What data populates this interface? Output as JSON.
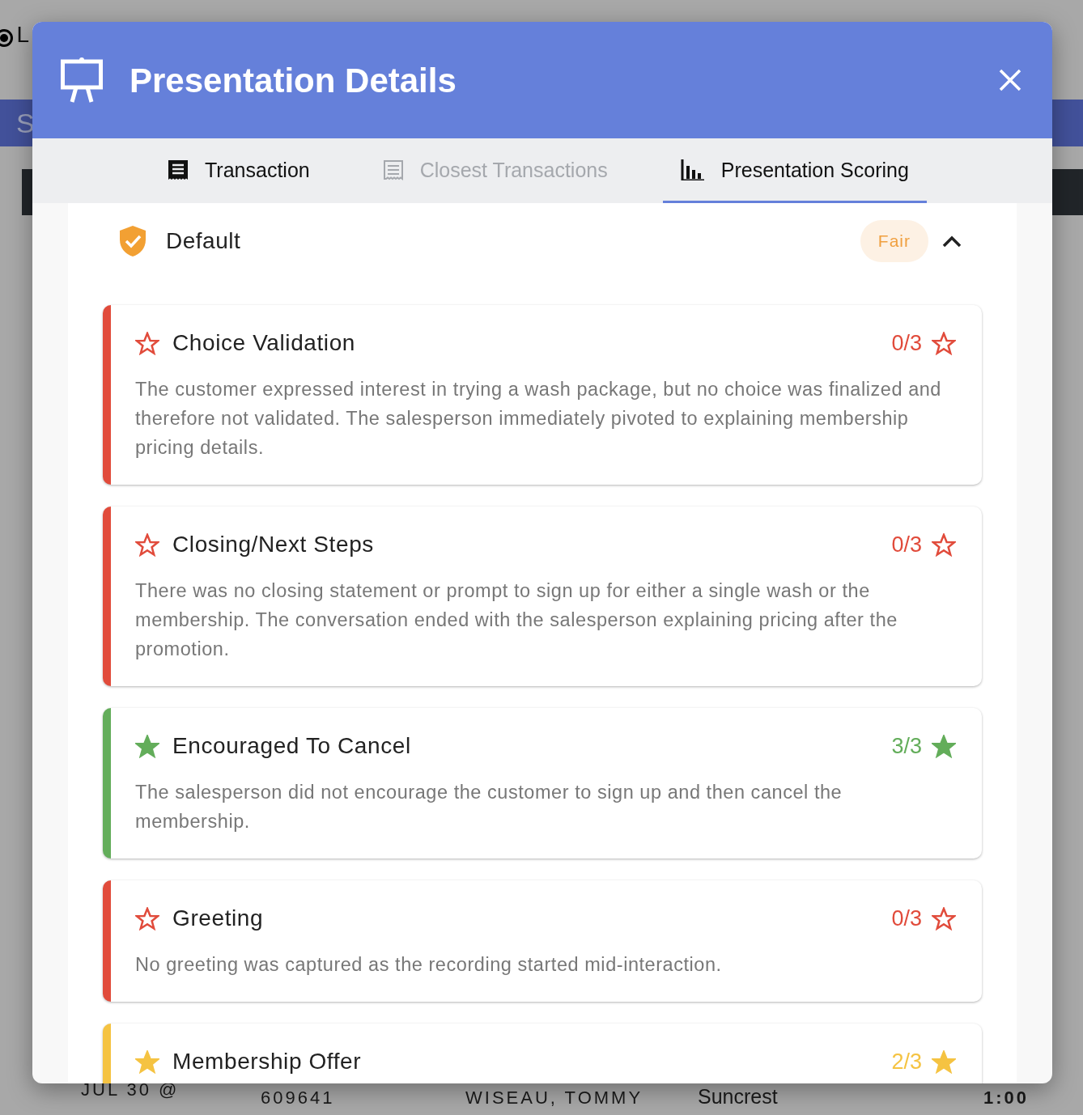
{
  "background": {
    "radio_checked": true,
    "radio_label": "L",
    "bar_text": "S",
    "row": {
      "date": "JUL 30 @",
      "number": "609641",
      "name": "WISEAU, TOMMY",
      "location": "Suncrest",
      "duration": "1:00"
    }
  },
  "dialog": {
    "title": "Presentation Details"
  },
  "tabs": [
    {
      "label": "Transaction",
      "selected": false,
      "disabled": false
    },
    {
      "label": "Closest Transactions",
      "selected": false,
      "disabled": true
    },
    {
      "label": "Presentation Scoring",
      "selected": true,
      "disabled": false
    }
  ],
  "section": {
    "title": "Default",
    "rating": "Fair",
    "expanded": true,
    "items": [
      {
        "title": "Choice Validation",
        "score": "0/3",
        "color": "#e14b3b",
        "star_filled": false,
        "description": "The customer expressed interest in trying a wash package, but no choice was finalized and therefore not validated. The salesperson immediately pivoted to explaining membership pricing details."
      },
      {
        "title": "Closing/Next Steps",
        "score": "0/3",
        "color": "#e14b3b",
        "star_filled": false,
        "description": "There was no closing statement or prompt to sign up for either a single wash or the membership. The conversation ended with the salesperson explaining pricing after the promotion."
      },
      {
        "title": "Encouraged To Cancel",
        "score": "3/3",
        "color": "#63ad5a",
        "star_filled": true,
        "description": "The salesperson did not encourage the customer to sign up and then cancel the membership."
      },
      {
        "title": "Greeting",
        "score": "0/3",
        "color": "#e14b3b",
        "star_filled": false,
        "description": "No greeting was captured as the recording started mid-interaction."
      },
      {
        "title": "Membership Offer",
        "score": "2/3",
        "color": "#f5c342",
        "star_filled": true
      }
    ]
  }
}
